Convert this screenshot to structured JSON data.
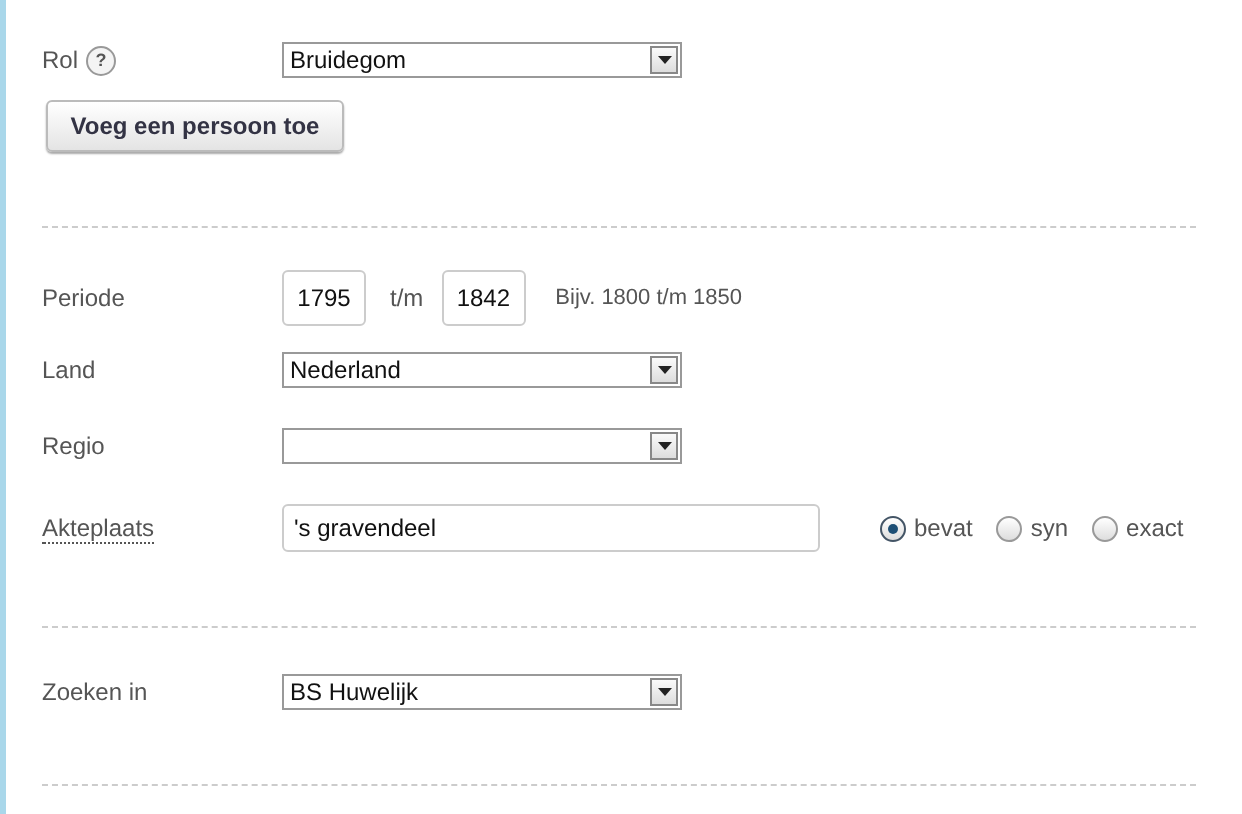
{
  "rol": {
    "label": "Rol",
    "help": "?",
    "value": "Bruidegom"
  },
  "add_button": "Voeg een persoon toe",
  "periode": {
    "label": "Periode",
    "from": "1795",
    "separator": "t/m",
    "to": "1842",
    "hint": "Bijv. 1800 t/m 1850"
  },
  "land": {
    "label": "Land",
    "value": "Nederland"
  },
  "regio": {
    "label": "Regio"
  },
  "akteplaats": {
    "label": "Akteplaats",
    "value": "'s gravendeel",
    "options": [
      {
        "label": "bevat",
        "selected": true
      },
      {
        "label": "syn",
        "selected": false
      },
      {
        "label": "exact",
        "selected": false
      }
    ]
  },
  "zoeken_in": {
    "label": "Zoeken in",
    "value": "BS Huwelijk"
  }
}
